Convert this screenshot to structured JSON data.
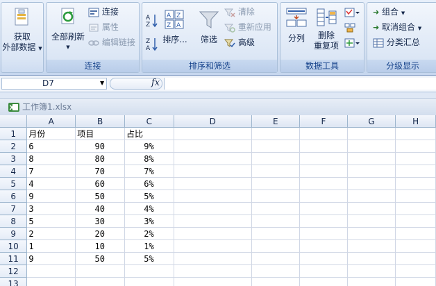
{
  "ribbon": {
    "get_data": {
      "line1": "获取",
      "line2": "外部数据"
    },
    "connections": {
      "refresh_all": "全部刷新",
      "connections": "连接",
      "properties": "属性",
      "edit_links": "编辑链接",
      "label": "连接"
    },
    "sort_filter": {
      "sort": "排序...",
      "filter": "筛选",
      "clear": "清除",
      "reapply": "重新应用",
      "advanced": "高级",
      "label": "排序和筛选"
    },
    "data_tools": {
      "text_to_columns": "分列",
      "remove_duplicates_1": "删除",
      "remove_duplicates_2": "重复项",
      "label": "数据工具"
    },
    "outline": {
      "group": "组合",
      "ungroup": "取消组合",
      "subtotal": "分类汇总",
      "label": "分级显示"
    }
  },
  "formula_bar": {
    "name_box": "D7",
    "fx": "fx",
    "value": ""
  },
  "workbook": {
    "title": "工作簿1.xlsx"
  },
  "sheet": {
    "columns": [
      "A",
      "B",
      "C",
      "D",
      "E",
      "F",
      "G",
      "H"
    ],
    "rows": [
      {
        "n": "1",
        "a": "月份",
        "b": "项目",
        "c": "占比"
      },
      {
        "n": "2",
        "a": "6",
        "b": "90",
        "c": "9%"
      },
      {
        "n": "3",
        "a": "8",
        "b": "80",
        "c": "8%"
      },
      {
        "n": "4",
        "a": "7",
        "b": "70",
        "c": "7%"
      },
      {
        "n": "5",
        "a": "4",
        "b": "60",
        "c": "6%"
      },
      {
        "n": "6",
        "a": "9",
        "b": "50",
        "c": "5%"
      },
      {
        "n": "7",
        "a": "3",
        "b": "40",
        "c": "4%"
      },
      {
        "n": "8",
        "a": "5",
        "b": "30",
        "c": "3%"
      },
      {
        "n": "9",
        "a": "2",
        "b": "20",
        "c": "2%"
      },
      {
        "n": "10",
        "a": "1",
        "b": "10",
        "c": "1%"
      },
      {
        "n": "11",
        "a": "9",
        "b": "50",
        "c": "5%"
      },
      {
        "n": "12",
        "a": "",
        "b": "",
        "c": ""
      },
      {
        "n": "13",
        "a": "",
        "b": "",
        "c": ""
      }
    ]
  }
}
